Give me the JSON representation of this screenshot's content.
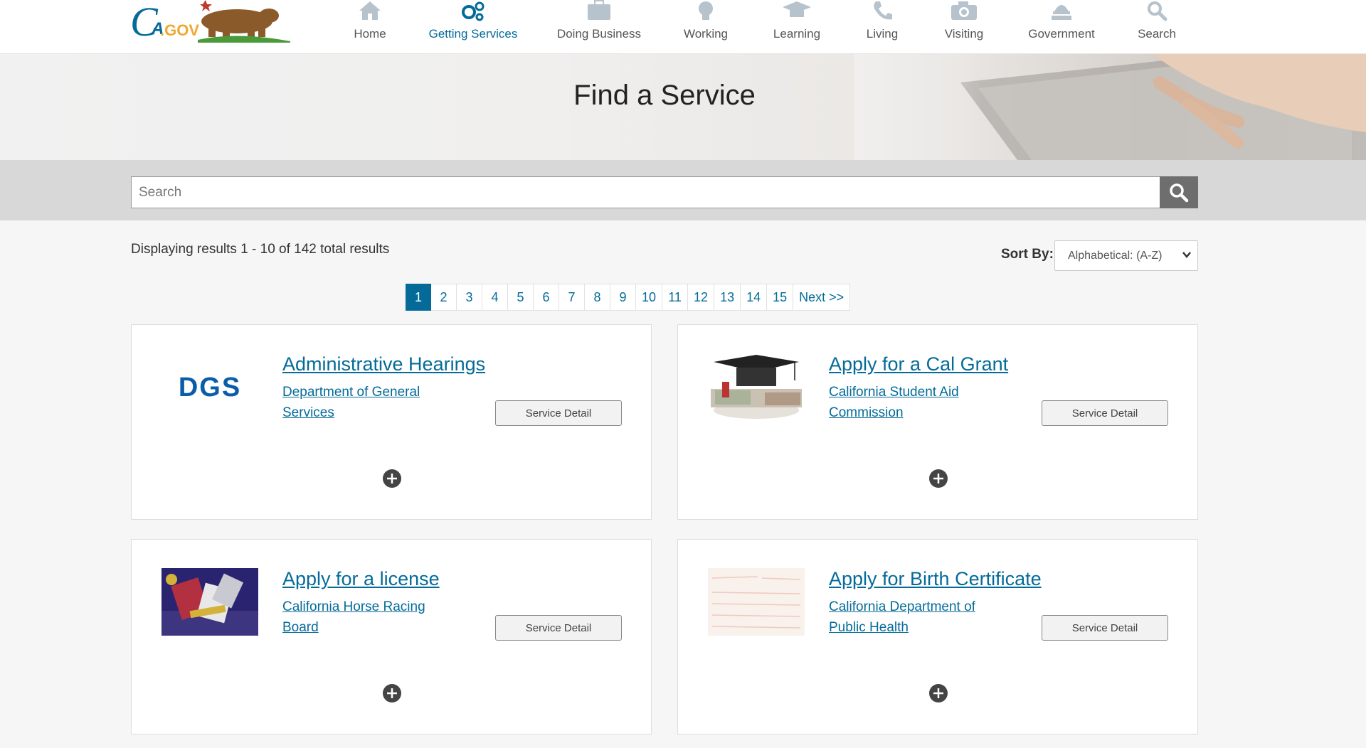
{
  "header": {
    "logo_alt": "CA.GOV",
    "nav": [
      {
        "label": "Home",
        "icon": "home-icon"
      },
      {
        "label": "Getting Services",
        "icon": "gears-icon",
        "active": true
      },
      {
        "label": "Doing Business",
        "icon": "briefcase-icon"
      },
      {
        "label": "Working",
        "icon": "lightbulb-icon"
      },
      {
        "label": "Learning",
        "icon": "graduation-cap-icon"
      },
      {
        "label": "Living",
        "icon": "phone-icon"
      },
      {
        "label": "Visiting",
        "icon": "camera-icon"
      },
      {
        "label": "Government",
        "icon": "capitol-icon"
      },
      {
        "label": "Search",
        "icon": "search-icon"
      }
    ]
  },
  "banner": {
    "title": "Find a Service"
  },
  "search": {
    "placeholder": "Search"
  },
  "results": {
    "summary": "Displaying results 1 - 10 of 142 total results",
    "sort_label": "Sort By:",
    "sort_value": "Alphabetical: (A-Z)"
  },
  "pagination": {
    "pages": [
      "1",
      "2",
      "3",
      "4",
      "5",
      "6",
      "7",
      "8",
      "9",
      "10",
      "11",
      "12",
      "13",
      "14",
      "15"
    ],
    "current": "1",
    "next_label": "Next >>"
  },
  "cards": [
    {
      "title": "Administrative Hearings",
      "agency": "Department of General Services",
      "button": "Service Detail",
      "thumb_text": "DGS"
    },
    {
      "title": "Apply for a Cal Grant",
      "agency": "California Student Aid Commission",
      "button": "Service Detail"
    },
    {
      "title": "Apply for a license",
      "agency": "California Horse Racing Board",
      "button": "Service Detail"
    },
    {
      "title": "Apply for Birth Certificate",
      "agency": "California Department of Public Health",
      "button": "Service Detail"
    }
  ],
  "colors": {
    "link": "#046b99",
    "accent_gold": "#f0a830",
    "header_bg": "#ffffff",
    "search_band": "#d8d8d8"
  }
}
